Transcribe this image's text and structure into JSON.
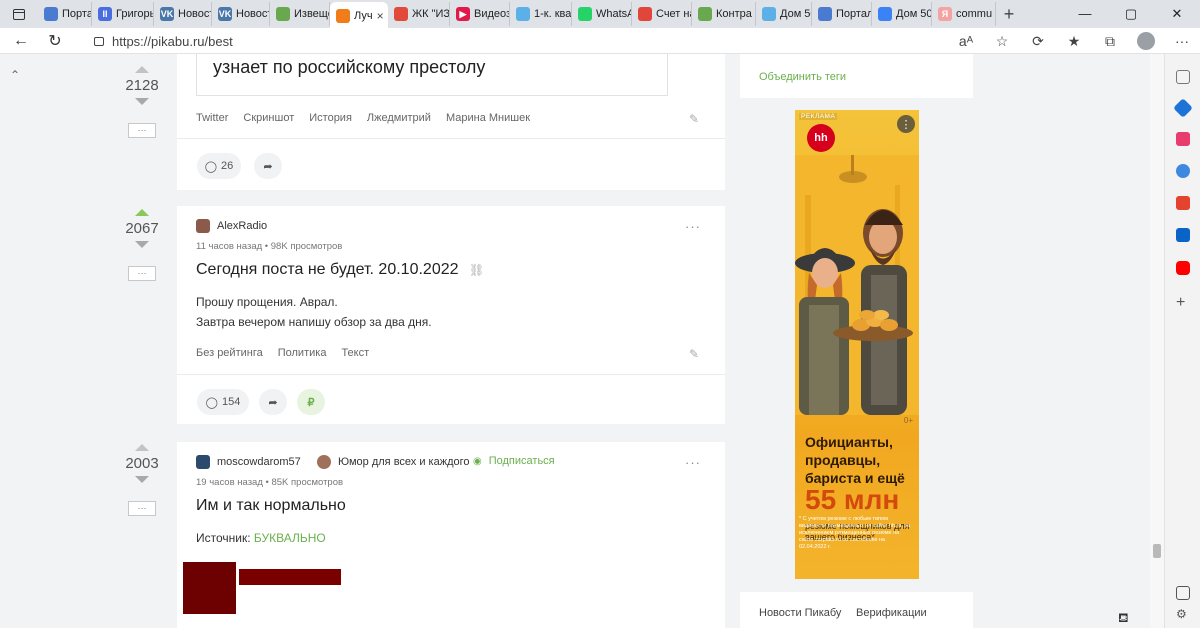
{
  "browser": {
    "tabs": [
      {
        "label": "Портал",
        "color": "#4a7bd0",
        "glyph": ""
      },
      {
        "label": "Григорь",
        "color": "#4a6ee0",
        "glyph": "II"
      },
      {
        "label": "Новост",
        "color": "#4a76a8",
        "glyph": "VK"
      },
      {
        "label": "Новост",
        "color": "#4a76a8",
        "glyph": "VK"
      },
      {
        "label": "Извеще",
        "color": "#6aa84f",
        "glyph": ""
      },
      {
        "label": "Луч",
        "color": "#f07c1a",
        "glyph": "",
        "active": true
      },
      {
        "label": "ЖК \"ИЗ",
        "color": "#e24b3b",
        "glyph": ""
      },
      {
        "label": "Видеоз",
        "color": "#e01b4a",
        "glyph": "▶"
      },
      {
        "label": "1-к. ква",
        "color": "#5bb0e8",
        "glyph": ""
      },
      {
        "label": "WhatsA",
        "color": "#25d366",
        "glyph": ""
      },
      {
        "label": "Счет на",
        "color": "#e2463b",
        "glyph": ""
      },
      {
        "label": "Контра",
        "color": "#6aa84f",
        "glyph": ""
      },
      {
        "label": "Дом 50",
        "color": "#5bb0e8",
        "glyph": ""
      },
      {
        "label": "Портал",
        "color": "#4a7bd0",
        "glyph": ""
      },
      {
        "label": "Дом 50",
        "color": "#3b82f6",
        "glyph": ""
      },
      {
        "label": "commu",
        "color": "#f4a2a2",
        "glyph": "Я"
      }
    ],
    "url": "https://pikabu.ru/best",
    "window_buttons": [
      "—",
      "▢",
      "✕"
    ],
    "addr_icons": [
      "aᴬ",
      "☆",
      "⟳",
      "★",
      "⧉"
    ]
  },
  "posts": [
    {
      "rating": "2128",
      "title_fragment": "узнает по российскому престолу",
      "tags": [
        "Twitter",
        "Скриншот",
        "История",
        "Лжедмитрий",
        "Марина Мнишек"
      ],
      "comments": "26"
    },
    {
      "rating": "2067",
      "author": "AlexRadio",
      "meta": "11 часов назад • 98K просмотров",
      "title": "Сегодня поста не будет. 20.10.2022",
      "body": [
        "Прошу прощения. Аврал.",
        "Завтра вечером напишу обзор за два дня."
      ],
      "tags": [
        "Без рейтинга",
        "Политика",
        "Текст"
      ],
      "comments": "154"
    },
    {
      "rating": "2003",
      "author": "moscowdarom57",
      "community": "Юмор для всех и каждого",
      "subscribe": "Подписаться",
      "meta": "19 часов назад • 85K просмотров",
      "title": "Им и так нормально",
      "source_label": "Источник:",
      "source_link": "БУКВАЛЬНО"
    }
  ],
  "sidebar": {
    "merge_tags": "Объединить теги",
    "footer_links": [
      "Новости Пикабу",
      "Верификации"
    ]
  },
  "ad": {
    "badge": "РЕКЛАМА",
    "logo": "hh",
    "age": "0+",
    "headline": "Официанты, продавцы, бариста и ещё",
    "big": "55 млн",
    "sub": "резюме помощников для вашего бизнеса*",
    "disclaimer": "* С учетом резюме с любым типом видимости размещенных на сайте hh.ru, за исключением размещенных резюме на сайте zarplata.ru по состоянию на 02.04.2022 г."
  },
  "colors": {
    "accent_green": "#6ab04c",
    "ad_orange": "#f2b526"
  }
}
